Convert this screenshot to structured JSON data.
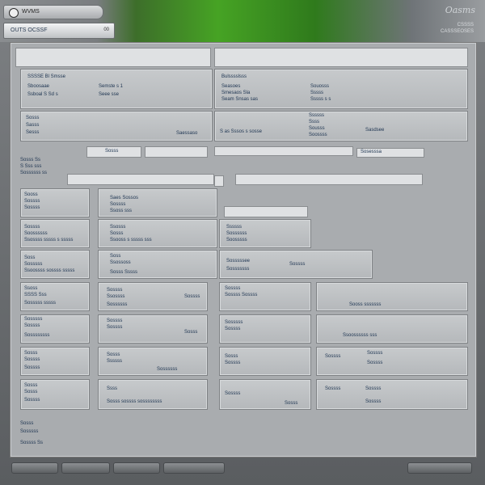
{
  "title_tab": "WVMS",
  "status": {
    "label": "OUTS OCSSF",
    "version": "00"
  },
  "brand": {
    "name": "Oasms",
    "sub1": "CSSSS",
    "sub2": "CASSSEOSES"
  },
  "top_fields": [
    "",
    ""
  ],
  "grp1": {
    "heading": "SSSSE Bl Smsse",
    "lines": [
      "Sboosaae",
      "Ssboal S Sd s"
    ],
    "col2": [
      "Semste s 1",
      "Seee sse"
    ]
  },
  "grp2": {
    "heading": "Bulsssslsss",
    "lines": [
      "Seasoes",
      "Smesaos Sla",
      "Seam Snsas sas"
    ],
    "col2": [
      "Souosss",
      "Sssss",
      "Sssss s s"
    ]
  },
  "row3": {
    "left": [
      "Sosss",
      "Sasss",
      "Sesss"
    ],
    "mid": "Saessaso",
    "right_a": "S as Sssos s sosse",
    "right_b": [
      "Ssssss",
      "Ssss",
      "Sousss",
      "Soossss"
    ],
    "right_c": "Sasdsee"
  },
  "row4": {
    "a": "Sosss",
    "b": "",
    "c": "Sosesssa"
  },
  "left_labels": [
    "Sosss Ss",
    "S Sss sss",
    "Sossssss ss"
  ],
  "row5_fields": [
    "",
    "",
    ""
  ],
  "table": [
    {
      "a": [
        "Sooss",
        "Sossss",
        "Sossss"
      ],
      "b": [
        "Saes Sossos",
        "Sossss",
        "Ssoss sss"
      ]
    },
    {
      "a": [
        "Sossss",
        "Soossssss",
        "Ssossss sssss s sssss"
      ],
      "b": [
        "Ssosss",
        "Sosss",
        "Ssooss s sssss sss"
      ],
      "c": [
        "Ssssss",
        "Sossssss",
        "Soosssss"
      ]
    },
    {
      "a": [
        "Soss",
        "Sosssss",
        "Ssoossss sossss sssss"
      ],
      "b": [
        "Soss",
        "Ssossoss",
        "Sosss Sssss"
      ],
      "c": [
        "Sosssssee",
        "Sosssssss"
      ],
      "d": "Sossss"
    },
    {
      "a": [
        "Ssoss",
        "SSSS Sss",
        "Sosssss sssss"
      ],
      "b": [
        "Sossss",
        "Ssossss",
        "Sossssss"
      ],
      "c": [
        "Sossss",
        "Sossss Sossss"
      ],
      "d": "Sossss",
      "e": "Sooss sssssss"
    },
    {
      "a": [
        "Sosssss",
        "Sossss",
        "Sossssssss"
      ],
      "b": [
        "Sossss",
        "Sossss"
      ],
      "c": [
        "Sosssss",
        "Sossss"
      ],
      "d": "Sosss",
      "e": "Ssoossssss sss"
    },
    {
      "a": [
        "Sosss",
        "Sossss",
        "Sossss"
      ],
      "b": [
        "Sosss",
        "Ssssss"
      ],
      "c": [
        "Sosss",
        "Sossss"
      ],
      "d": "Sossssss",
      "e": [
        "Sossss",
        "Sossss",
        "Sossss"
      ]
    },
    {
      "a": [
        "Sosss",
        "Sosss",
        "Sossss"
      ],
      "b": [
        "Ssss",
        "Sosss sossss sossssssss"
      ],
      "c": [
        "Sossss"
      ],
      "d": "Sosss",
      "e": [
        "Sossss",
        "Sossss",
        "Sossss"
      ]
    }
  ],
  "footer_labels": [
    "Sosss",
    "Sosssss",
    "Sossss Ss"
  ],
  "buttons": [
    "",
    "",
    "",
    "",
    ""
  ]
}
